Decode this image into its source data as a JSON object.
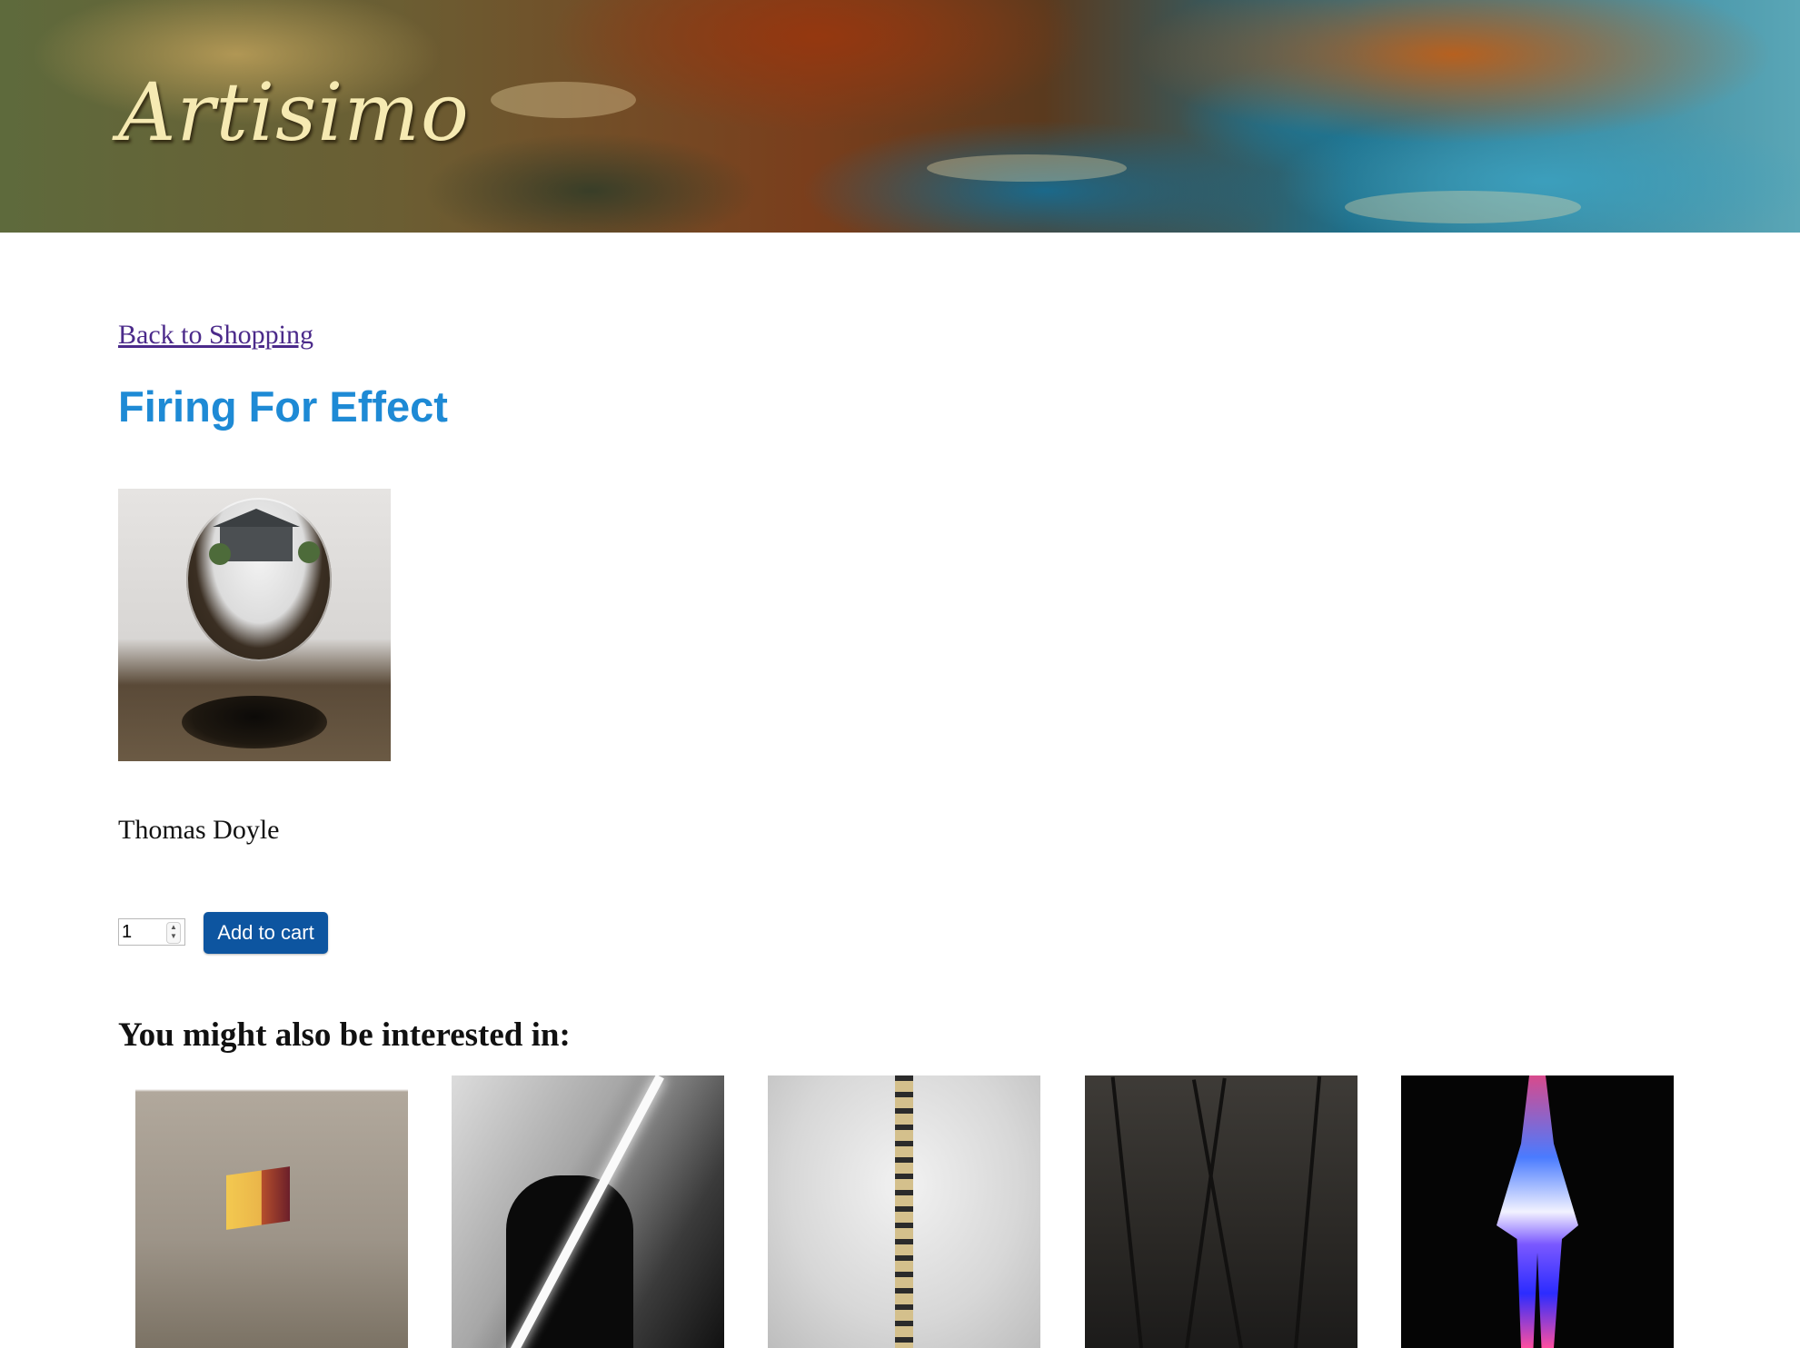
{
  "header": {
    "logo_text": "Artisimo"
  },
  "nav": {
    "back_link": "Back to Shopping"
  },
  "product": {
    "title": "Firing For Effect",
    "artist": "Thomas Doyle",
    "quantity": "1",
    "add_to_cart_label": "Add to cart",
    "title_color": "#1e8ad5",
    "button_color": "#0d55a0"
  },
  "related": {
    "heading": "You might also be interested in:",
    "items": [
      {
        "icon": "artwork-thumbnail"
      },
      {
        "icon": "artwork-thumbnail"
      },
      {
        "icon": "artwork-thumbnail"
      },
      {
        "icon": "artwork-thumbnail"
      },
      {
        "icon": "artwork-thumbnail"
      }
    ]
  }
}
